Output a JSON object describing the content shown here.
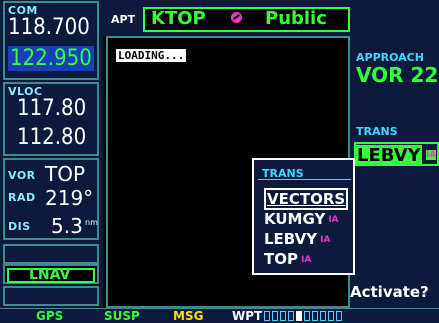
{
  "com": {
    "label": "COM",
    "active": "118.700",
    "standby": "122.950"
  },
  "vloc": {
    "label": "VLOC",
    "active": "117.80",
    "standby": "112.80"
  },
  "vor": {
    "label": "VOR",
    "ident": "TOP",
    "rad_label": "RAD",
    "rad_value": "219°",
    "dis_label": "DIS",
    "dis_value": "5.3",
    "dis_unit": "nm"
  },
  "nav_mode": "LNAV",
  "header": {
    "apt_label": "APT",
    "airport_id": "KTOP",
    "type": "Public"
  },
  "map": {
    "status": "LOADING..."
  },
  "approach": {
    "label": "APPROACH",
    "value": "VOR 22"
  },
  "trans": {
    "label": "TRANS",
    "value": "LEBVY",
    "value_suffix": "IA"
  },
  "popup": {
    "title": "TRANS",
    "items": [
      {
        "name": "VECTORS",
        "suffix": ""
      },
      {
        "name": "KUMGY",
        "suffix": "IA"
      },
      {
        "name": "LEBVY",
        "suffix": "IA"
      },
      {
        "name": "TOP",
        "suffix": "IA"
      }
    ]
  },
  "activate_label": "Activate?",
  "bottom": {
    "gps": "GPS",
    "susp": "SUSP",
    "msg": "MSG",
    "wpt": "WPT",
    "page_count": 10,
    "current_page": 4
  },
  "colors": {
    "panel": "#0c1a3e",
    "green": "#34ff3a",
    "cyan": "#40d8ff",
    "magenta": "#e838c8",
    "border": "#3c8c8c"
  }
}
